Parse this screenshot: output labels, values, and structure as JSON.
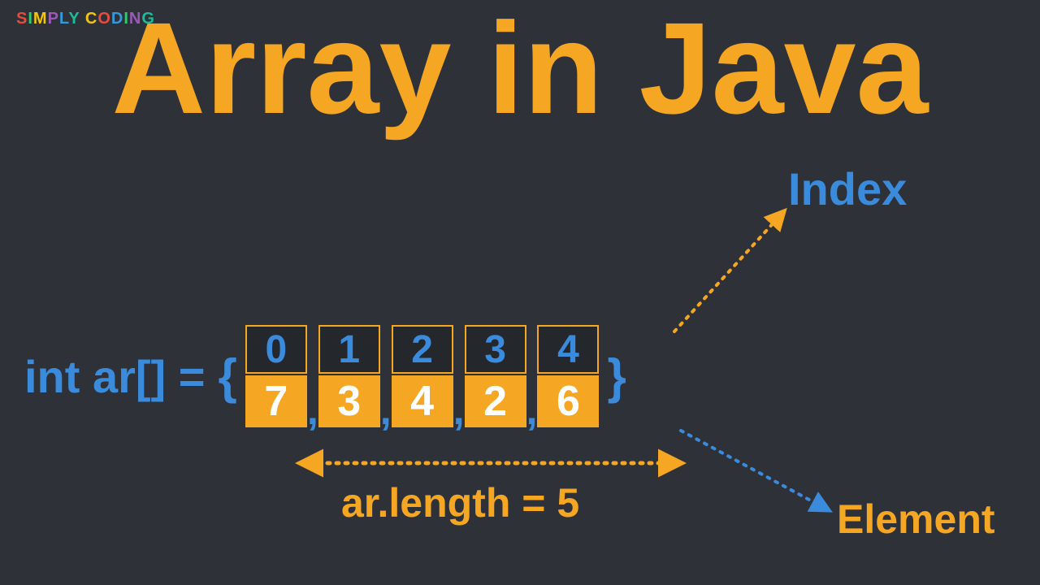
{
  "logo": {
    "word1": "SIMPLY",
    "word2": "CODING"
  },
  "title": "Array in Java",
  "declaration": "int ar[] = {",
  "brace_open": "{",
  "brace_close": "}",
  "array": {
    "indices": [
      "0",
      "1",
      "2",
      "3",
      "4"
    ],
    "values": [
      "7",
      "3",
      "4",
      "2",
      "6"
    ]
  },
  "labels": {
    "index": "Index",
    "element": "Element",
    "length": "ar.length = 5"
  }
}
